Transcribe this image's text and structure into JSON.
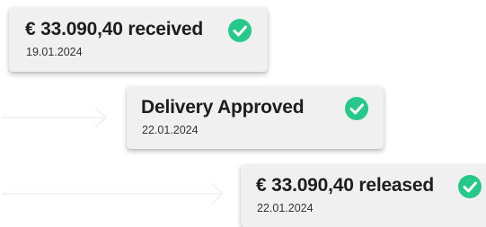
{
  "events": [
    {
      "title": "€ 33.090,40  received",
      "date": "19.01.2024"
    },
    {
      "title": "Delivery Approved",
      "date": "22.01.2024"
    },
    {
      "title": "€ 33.090,40  released",
      "date": "22.01.2024"
    }
  ],
  "icons": {
    "status": "check-circle-icon",
    "connector": "arrow-right-icon"
  },
  "colors": {
    "check": "#27c98a",
    "card_background": "#f0f0f0",
    "connector": "#f3f3f3"
  }
}
